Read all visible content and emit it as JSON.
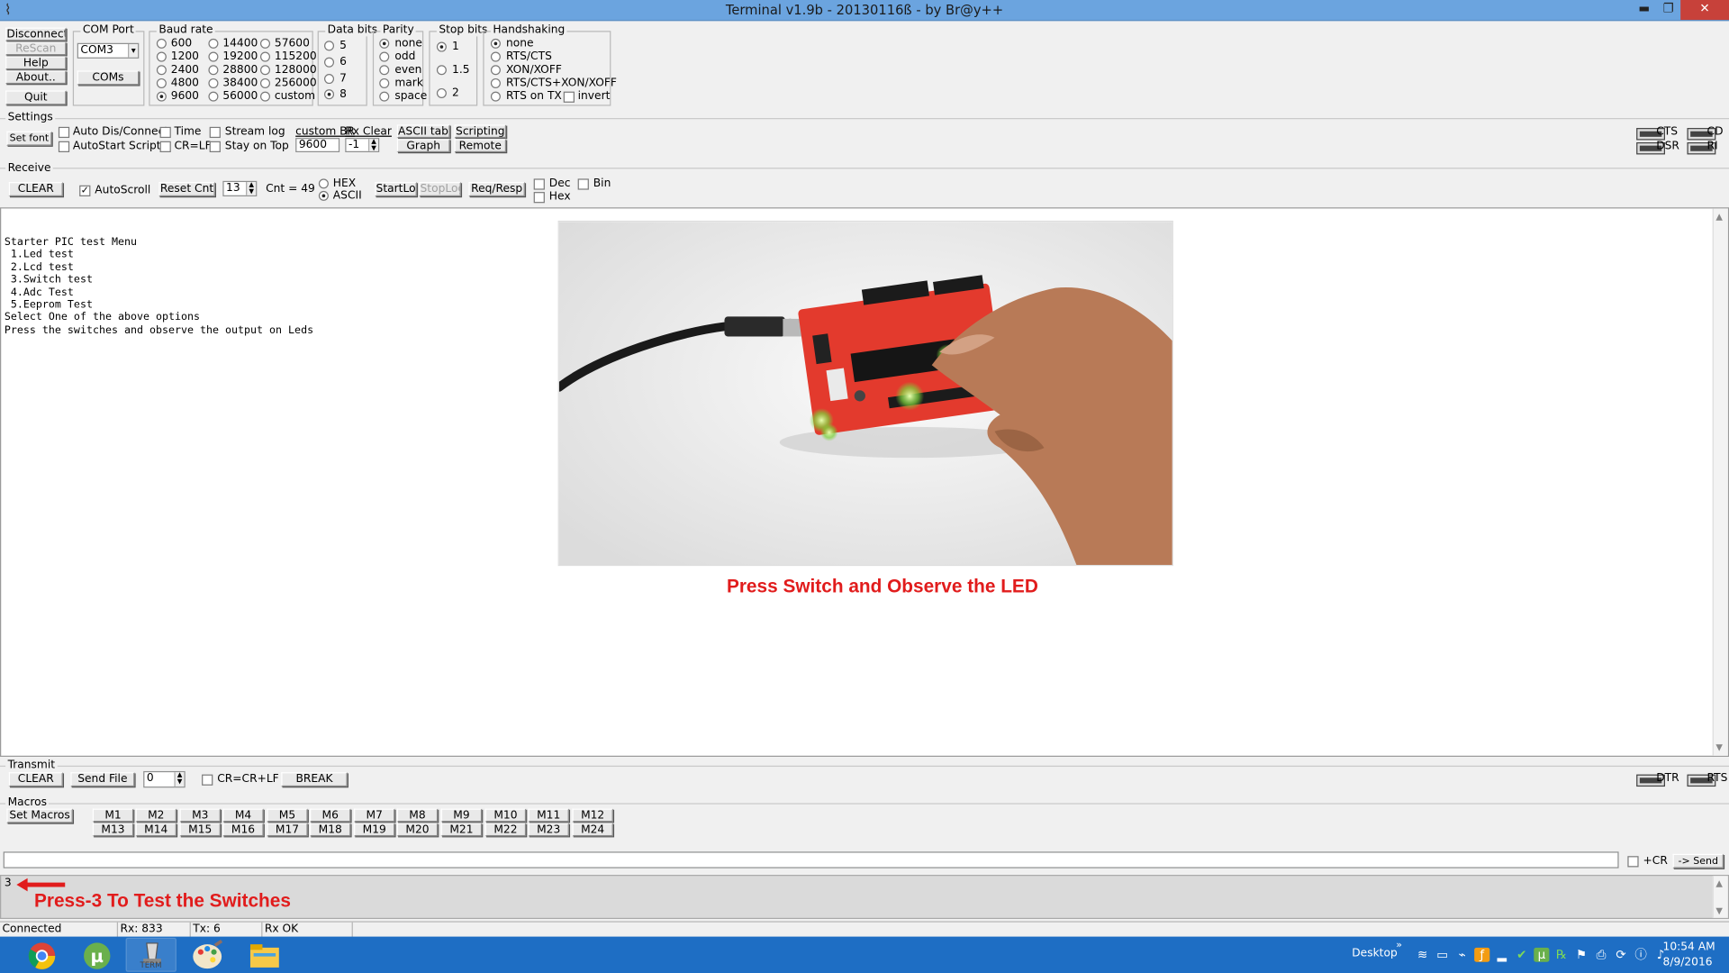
{
  "window": {
    "title": "Terminal v1.9b - 20130116ß - by Br@y++",
    "minimize": "▬",
    "maximize": "❐",
    "close": "✕"
  },
  "connection": {
    "disconnect": "Disconnect",
    "rescan": "ReScan",
    "help": "Help",
    "about": "About..",
    "quit": "Quit"
  },
  "com_port": {
    "label": "COM Port",
    "value": "COM3",
    "coms_button": "COMs"
  },
  "baud_rate": {
    "label": "Baud rate",
    "options": [
      "600",
      "1200",
      "2400",
      "4800",
      "9600",
      "14400",
      "19200",
      "28800",
      "38400",
      "56000",
      "57600",
      "115200",
      "128000",
      "256000",
      "custom"
    ],
    "selected": "9600"
  },
  "data_bits": {
    "label": "Data bits",
    "options": [
      "5",
      "6",
      "7",
      "8"
    ],
    "selected": "8"
  },
  "parity": {
    "label": "Parity",
    "options": [
      "none",
      "odd",
      "even",
      "mark",
      "space"
    ],
    "selected": "none"
  },
  "stop_bits": {
    "label": "Stop bits",
    "options": [
      "1",
      "1.5",
      "2"
    ],
    "selected": "1"
  },
  "handshaking": {
    "label": "Handshaking",
    "options": [
      "none",
      "RTS/CTS",
      "XON/XOFF",
      "RTS/CTS+XON/XOFF",
      "RTS on TX"
    ],
    "invert": "invert",
    "selected": "none"
  },
  "settings": {
    "label": "Settings",
    "set_font": "Set font",
    "auto_dis_connect": "Auto Dis/Connect",
    "autostart_script": "AutoStart Script",
    "time": "Time",
    "cr_lf": "CR=LF",
    "stream_log": "Stream log",
    "stay_on_top": "Stay on Top",
    "custom_br_label": "custom BR",
    "custom_br_value": "9600",
    "rx_clear_label": "Rx Clear",
    "rx_clear_value": "-1",
    "ascii_table": "ASCII table",
    "graph": "Graph",
    "scripting": "Scripting",
    "remote": "Remote",
    "cts": "CTS",
    "cd": "CD",
    "dsr": "DSR",
    "ri": "RI"
  },
  "receive": {
    "label": "Receive",
    "clear": "CLEAR",
    "autoscroll": "AutoScroll",
    "reset_cnt": "Reset Cnt",
    "cnt_spin": "13",
    "cnt_text": "Cnt =  49",
    "hex": "HEX",
    "ascii": "ASCII",
    "startlog": "StartLog",
    "stoplog": "StopLog",
    "req_resp": "Req/Resp",
    "dec": "Dec",
    "hex2": "Hex",
    "bin": "Bin",
    "lines": [
      "Starter PIC test Menu",
      " 1.Led test",
      " 2.Lcd test",
      " 3.Switch test",
      " 4.Adc Test",
      " 5.Eeprom Test",
      "Select One of the above options",
      "Press the switches and observe the output on Leds"
    ],
    "caption": "Press Switch and Observe the LED"
  },
  "transmit": {
    "label": "Transmit",
    "clear": "CLEAR",
    "send_file": "Send File",
    "spin": "0",
    "cr_crlf": "CR=CR+LF",
    "break": "BREAK",
    "dtr": "DTR",
    "rts": "RTS"
  },
  "macros": {
    "label": "Macros",
    "set_macros": "Set Macros",
    "row1": [
      "M1",
      "M2",
      "M3",
      "M4",
      "M5",
      "M6",
      "M7",
      "M8",
      "M9",
      "M10",
      "M11",
      "M12"
    ],
    "row2": [
      "M13",
      "M14",
      "M15",
      "M16",
      "M17",
      "M18",
      "M19",
      "M20",
      "M21",
      "M22",
      "M23",
      "M24"
    ]
  },
  "send": {
    "plus_cr": "+CR",
    "send_button": "-> Send",
    "sent_value": "3",
    "annotation": "Press-3 To Test the Switches"
  },
  "status": {
    "state": "Connected",
    "rx": "Rx: 833",
    "tx": "Tx: 6",
    "rx_status": "Rx OK"
  },
  "taskbar": {
    "apps": [
      "chrome-icon",
      "utorrent-icon",
      "terminal-icon",
      "paint-icon",
      "explorer-icon"
    ],
    "term_label": "TERM",
    "desktop": "Desktop",
    "time": "10:54 AM",
    "date": "8/9/2016"
  }
}
